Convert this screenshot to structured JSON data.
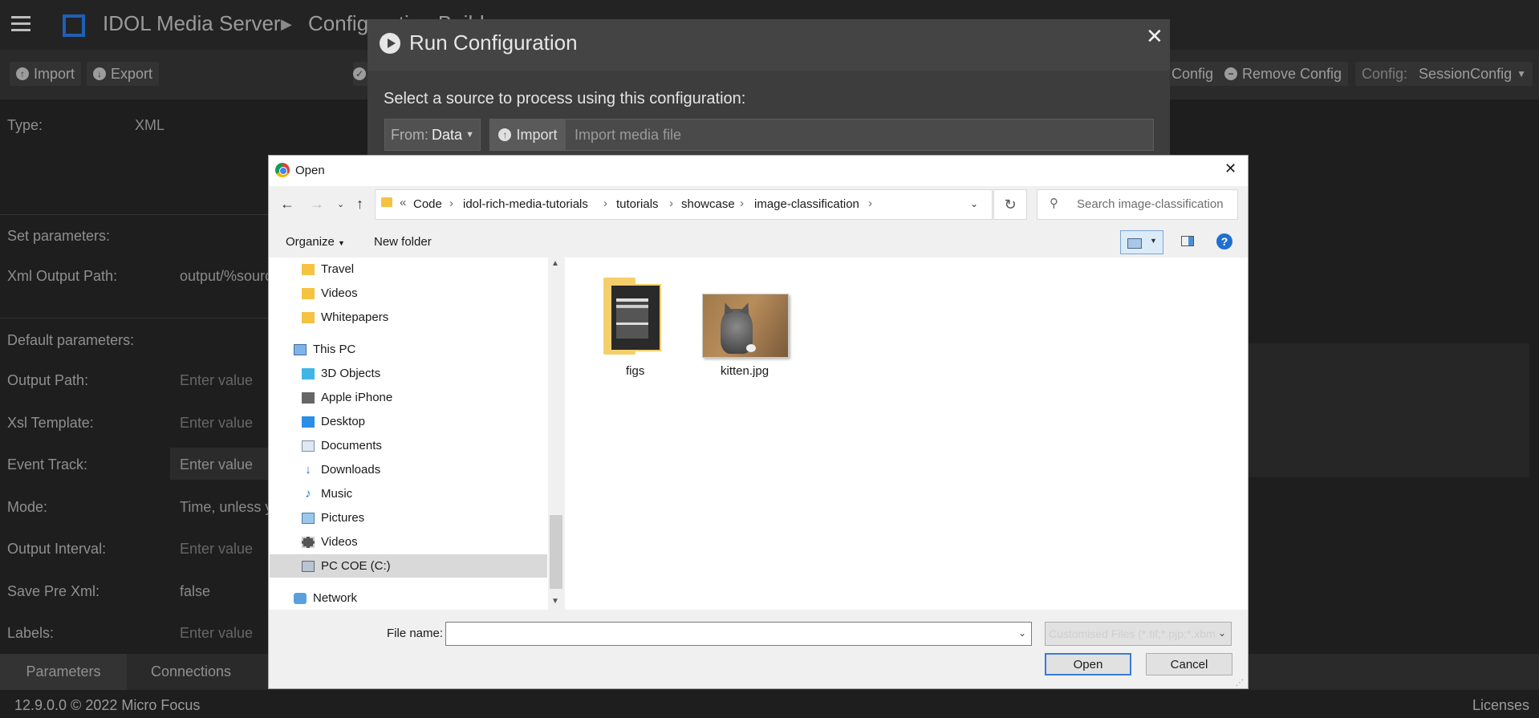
{
  "app": {
    "title": "IDOL Media Server",
    "crumb": "Configuration Builder",
    "toolbar": {
      "import": "Import",
      "export": "Export",
      "add_config": "Config",
      "remove_config": "Remove Config",
      "config_label": "Config:",
      "config_value": "SessionConfig"
    },
    "form": {
      "type_label": "Type:",
      "type_value": "XML",
      "set_params": "Set parameters:",
      "xml_output_label": "Xml Output Path:",
      "xml_output_value": "output/%source",
      "default_params": "Default parameters:",
      "output_path_label": "Output Path:",
      "xsl_label": "Xsl Template:",
      "event_track_label": "Event Track:",
      "mode_label": "Mode:",
      "mode_value": "Time, unless yo",
      "output_interval_label": "Output Interval:",
      "save_pre_label": "Save Pre Xml:",
      "save_pre_value": "false",
      "labels_label": "Labels:",
      "placeholder": "Enter value"
    },
    "tabs": [
      "Parameters",
      "Connections"
    ],
    "footer": {
      "version": "12.9.0.0 © 2022 Micro Focus",
      "licenses": "Licenses"
    }
  },
  "run_config": {
    "title": "Run Configuration",
    "close": "✕",
    "prompt": "Select a source to process using this configuration:",
    "from_label": "From:",
    "from_value": "Data",
    "import_label": "Import",
    "import_placeholder": "Import media file"
  },
  "open_dialog": {
    "title": "Open",
    "close": "✕",
    "breadcrumb": [
      "Code",
      "idol-rich-media-tutorials",
      "tutorials",
      "showcase",
      "image-classification"
    ],
    "breadcrumb_prefix": "«",
    "search_placeholder": "Search image-classification",
    "organize": "Organize",
    "new_folder": "New folder",
    "nav": {
      "quick": [
        "Travel",
        "Videos",
        "Whitepapers"
      ],
      "this_pc": "This PC",
      "pc_items": [
        "3D Objects",
        "Apple iPhone",
        "Desktop",
        "Documents",
        "Downloads",
        "Music",
        "Pictures",
        "Videos",
        "PC COE (C:)"
      ],
      "network": "Network"
    },
    "files": [
      {
        "name": "figs",
        "kind": "folder"
      },
      {
        "name": "kitten.jpg",
        "kind": "image"
      }
    ],
    "filename_label": "File name:",
    "filename_value": "",
    "filetype": "Customised Files (*.tif;*.pjp;*.xbm",
    "open_button": "Open",
    "cancel_button": "Cancel"
  }
}
